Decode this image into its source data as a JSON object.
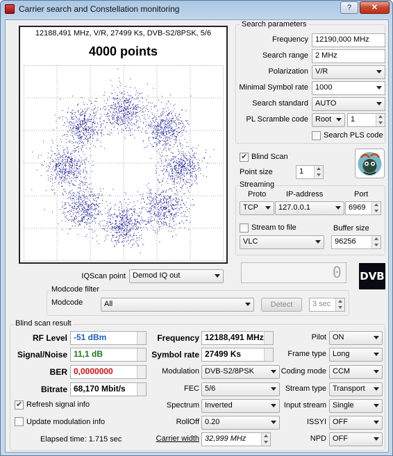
{
  "window": {
    "title": "Carrier search and Constellation monitoring",
    "help_label": "?",
    "close_label": "✕"
  },
  "plot": {
    "header": "12188,491 MHz, V/R, 27499 Ks, DVB-S2/8PSK, 5/6",
    "points_title": "4000 points",
    "point_color": "#1a1a9a"
  },
  "chart_data": {
    "type": "scatter",
    "title": "4000 points",
    "subtitle": "12188,491 MHz, V/R, 27499 Ks, DVB-S2/8PSK, 5/6",
    "xlabel": "",
    "ylabel": "",
    "grid": true,
    "n_points": 4000,
    "constellation": "8PSK",
    "cluster_angles_deg": [
      0,
      45,
      90,
      135,
      180,
      225,
      270,
      315
    ]
  },
  "search": {
    "group_label": "Search parameters",
    "frequency_label": "Frequency",
    "frequency_value": "12190,000 MHz",
    "range_label": "Search range",
    "range_value": "2 MHz",
    "polarization_label": "Polarization",
    "polarization_value": "V/R",
    "symrate_label": "Minimal Symbol rate",
    "symrate_value": "1000",
    "standard_label": "Search standard",
    "standard_value": "AUTO",
    "scramble_label": "PL Scramble code",
    "scramble_mode": "Root",
    "scramble_value": "1",
    "pls_label": "Search PLS code"
  },
  "blind": {
    "label": "Blind Scan",
    "checked": true,
    "point_size_label": "Point size",
    "point_size_value": "1"
  },
  "streaming": {
    "group_label": "Streaming",
    "proto_label": "Proto",
    "ip_label": "IP-address",
    "port_label": "Port",
    "proto_value": "TCP",
    "ip_value": "127.0.0.1",
    "port_value": "6969",
    "stream_file_label": "Stream to file",
    "player_value": "VLC",
    "buffer_label": "Buffer size",
    "buffer_value": "96256"
  },
  "iq": {
    "label": "IQScan point",
    "value": "Demod IQ out",
    "counter": "0",
    "logo": "DVB"
  },
  "modcode": {
    "group_label": "Modcode filter",
    "label": "Modcode",
    "value": "All",
    "detect_label": "Detect",
    "sec_value": "3 sec"
  },
  "result": {
    "group_label": "Blind scan result",
    "rf_label": "RF Level",
    "rf_value": "-51 dBm",
    "rf_color": "#1e5fbf",
    "snr_label": "Signal/Noise",
    "snr_value": "11,1 dB",
    "snr_color": "#1a7a1a",
    "ber_label": "BER",
    "ber_value": "0,0000000",
    "ber_color": "#d01010",
    "bitrate_label": "Bitrate",
    "bitrate_value": "68,170 Mbit/s",
    "freq_label": "Frequency",
    "freq_value": "12188,491 MHz",
    "symrate_label": "Symbol rate",
    "symrate_value": "27499 Ks",
    "modulation_label": "Modulation",
    "modulation_value": "DVB-S2/8PSK",
    "fec_label": "FEC",
    "fec_value": "5/6",
    "spectrum_label": "Spectrum",
    "spectrum_value": "Inverted",
    "rolloff_label": "RollOff",
    "rolloff_value": "0.20",
    "carrier_label": "Carrier width",
    "carrier_value": "32,999 MHz",
    "pilot_label": "Pilot",
    "pilot_value": "ON",
    "frame_label": "Frame type",
    "frame_value": "Long",
    "coding_label": "Coding mode",
    "coding_value": "CCM",
    "stream_type_label": "Stream type",
    "stream_type_value": "Transport",
    "input_stream_label": "Input stream",
    "input_stream_value": "Single",
    "issyi_label": "ISSYI",
    "issyi_value": "OFF",
    "npd_label": "NPD",
    "npd_value": "OFF",
    "refresh_label": "Refresh signal info",
    "refresh_checked": true,
    "update_label": "Update modulation info",
    "update_checked": false,
    "elapsed": "Elapsed time: 1.715 sec"
  }
}
